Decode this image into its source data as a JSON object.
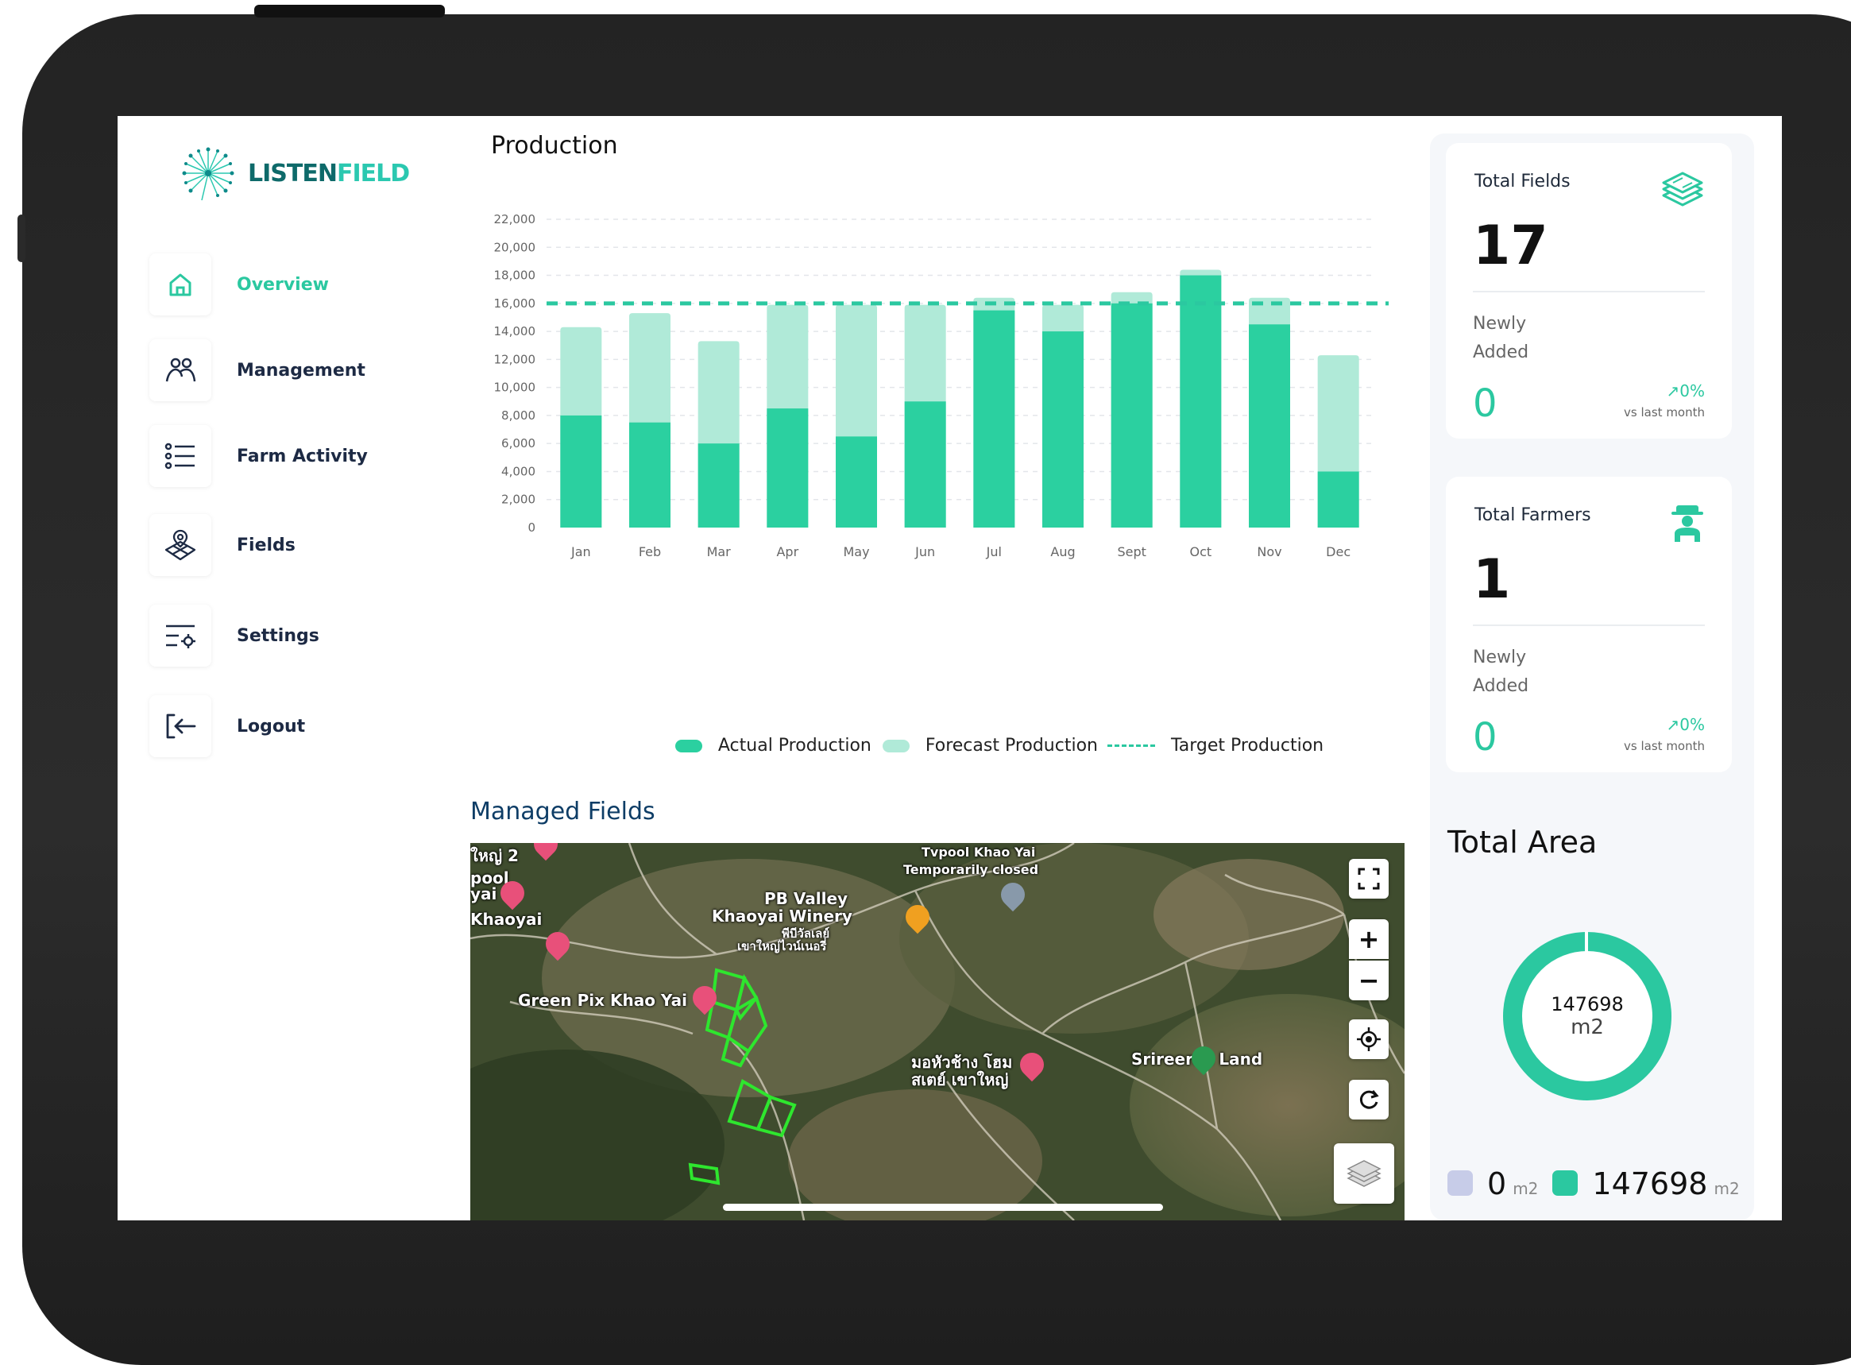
{
  "app": {
    "logo_part1": "LISTEN",
    "logo_part2": "FIELD"
  },
  "sidebar": {
    "items": [
      {
        "label": "Overview",
        "icon": "home-icon",
        "active": true
      },
      {
        "label": "Management",
        "icon": "users-icon"
      },
      {
        "label": "Farm Activity",
        "icon": "list-icon"
      },
      {
        "label": "Fields",
        "icon": "field-map-icon"
      },
      {
        "label": "Settings",
        "icon": "settings-list-icon"
      },
      {
        "label": "Logout",
        "icon": "logout-icon"
      }
    ]
  },
  "production": {
    "title": "Production"
  },
  "chart_data": {
    "type": "bar",
    "stacked": true,
    "categories": [
      "Jan",
      "Feb",
      "Mar",
      "Apr",
      "May",
      "Jun",
      "Jul",
      "Aug",
      "Sept",
      "Oct",
      "Nov",
      "Dec"
    ],
    "series": [
      {
        "name": "Actual Production",
        "values": [
          8000,
          7500,
          6000,
          8500,
          6500,
          9000,
          15500,
          14000,
          16000,
          18000,
          14500,
          4000
        ],
        "color": "#2bd0a0"
      },
      {
        "name": "Forecast Production",
        "values": [
          14300,
          15300,
          13300,
          15900,
          15900,
          15900,
          16400,
          15900,
          16800,
          18400,
          16400,
          12300
        ],
        "color": "#b0ead8"
      }
    ],
    "target": {
      "name": "Target Production",
      "value": 16000,
      "color": "#2bc8a0"
    },
    "y_ticks": [
      "0",
      "2,000",
      "4,000",
      "6,000",
      "8,000",
      "10,000",
      "12,000",
      "14,000",
      "16,000",
      "18,000",
      "20,000",
      "22,000"
    ],
    "ylim": [
      0,
      22000
    ],
    "grid": true,
    "legend": "bottom",
    "legend_labels": [
      "Actual Production",
      "Forecast Production",
      "Target Production"
    ]
  },
  "managed_fields": {
    "title": "Managed Fields",
    "map_labels": {
      "pb_valley": "PB Valley",
      "khaoyai_winery": "Khaoyai Winery",
      "pb_thai1": "พีบีวัลเลย์",
      "pb_thai2": "เขาใหญ่ไวน์เนอรี่",
      "green_pix": "Green Pix Khao Yai",
      "pool_closed1": "Tvpool Khao Yai",
      "pool_closed2": "Temporarily closed",
      "khaoyai": "Khaoyai",
      "pool": "pool",
      "yai": "yai",
      "yai2": "ใหญ่ 2",
      "thai_resort1": "มอหัวช้าง โฮม",
      "thai_resort2": "สเตย์ เขาใหญ่",
      "srireeras": "Srireeras Land"
    },
    "controls": {
      "zoom_in": "+",
      "zoom_out": "−"
    }
  },
  "stats": {
    "total_fields": {
      "title": "Total Fields",
      "value": "17",
      "sub": "Newly Added",
      "new": "0",
      "pct": "↗0%",
      "vs": "vs last month"
    },
    "total_farmers": {
      "title": "Total Farmers",
      "value": "1",
      "sub": "Newly Added",
      "new": "0",
      "pct": "↗0%",
      "vs": "vs last month"
    }
  },
  "total_area": {
    "title": "Total Area",
    "center_value": "147698",
    "center_unit": "m2",
    "legend": [
      {
        "value": "0",
        "unit": "m2",
        "color": "#c7cce8"
      },
      {
        "value": "147698",
        "unit": "m2",
        "color": "#2bc8a0"
      }
    ]
  }
}
